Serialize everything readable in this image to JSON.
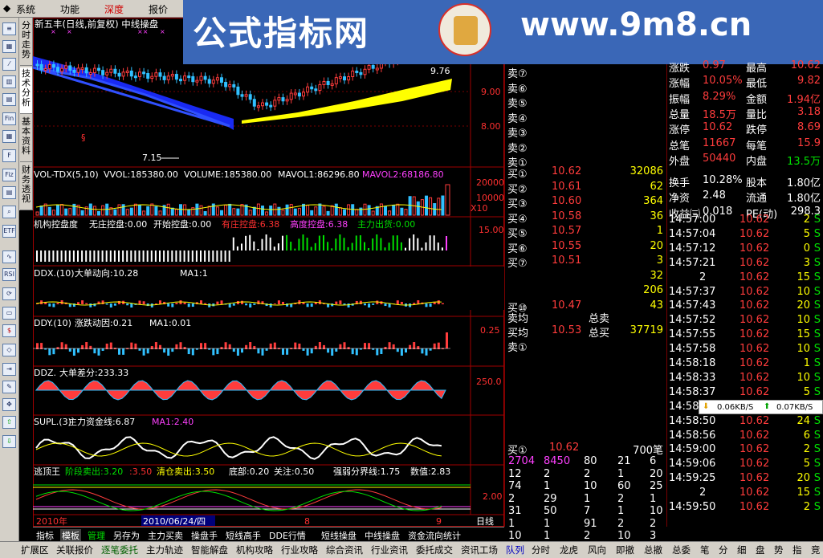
{
  "menu": [
    "系统",
    "功能",
    "深度",
    "报价"
  ],
  "side_tabs": [
    "分时走势",
    "技术分析",
    "基本资料",
    "财务透视"
  ],
  "banner": {
    "left": "公式指标网",
    "right": "www.9m8.cn"
  },
  "chart": {
    "title": "新五丰(日线,前复权) 中线操盘",
    "price_labels": {
      "p976": "9.76",
      "p900": "9.00",
      "p800": "8.00",
      "low": "7.15"
    },
    "vol_header": {
      "a": "VOL-TDX(5,10)",
      "b": "VVOL:185380.00",
      "c": "VOLUME:185380.00",
      "d": "MAVOL1:86296.80",
      "e": "MAVOL2:68186.80"
    },
    "vol_axis": {
      "a": "20000",
      "b": "10000",
      "c": "X10"
    },
    "p3_header": {
      "a": "机构控盘度",
      "b": "无庄控盘:0.00",
      "c": "开始控盘:0.00",
      "d": "有庄控盘:6.38",
      "e": "高度控盘:6.38",
      "f": "主力出货:0.00"
    },
    "p3_axis": "15.00",
    "ddx": {
      "a": "DDX.(10)",
      "b": "大单动向:10.28",
      "c": "MA1:1"
    },
    "ddy": {
      "a": "DDY.(10)",
      "b": "涨跌动因:0.21",
      "c": "MA1:0.01"
    },
    "ddy_axis": "0.25",
    "ddz": {
      "a": "DDZ.",
      "b": "大单差分:233.33"
    },
    "ddz_axis": "250.0",
    "supl": {
      "a": "SUPL.(3)",
      "b": "主力资金线:6.87",
      "c": "MA1:2.40"
    },
    "escape": {
      "a": "逃顶王",
      "b": "阶段卖出:3.20",
      "c": ":3.50",
      "d": "清仓卖出:3.50",
      "e": "底部:0.20",
      "f": "关注:0.50",
      "g": "强弱分界线:1.75",
      "h": "数值:2.83"
    },
    "escape_axis": "2.00",
    "dates": {
      "a": "2010年",
      "b": "2010/06/24/四",
      "c": "8",
      "d": "9",
      "e": "日线"
    }
  },
  "orderbook": {
    "sells": [
      "卖⑦",
      "卖⑥",
      "卖⑤",
      "卖④",
      "卖③",
      "卖②",
      "卖①"
    ],
    "buys": [
      {
        "l": "买①",
        "p": "10.62",
        "v": "32086"
      },
      {
        "l": "买②",
        "p": "10.61",
        "v": "62"
      },
      {
        "l": "买③",
        "p": "10.60",
        "v": "364"
      },
      {
        "l": "买④",
        "p": "10.58",
        "v": "36"
      },
      {
        "l": "买⑤",
        "p": "10.57",
        "v": "1"
      },
      {
        "l": "买⑥",
        "p": "10.55",
        "v": "20"
      },
      {
        "l": "买⑦",
        "p": "10.51",
        "v": "3"
      },
      {
        "l": "",
        "p": "",
        "v": "32"
      },
      {
        "l": "",
        "p": "",
        "v": "206"
      },
      {
        "l": "买⑩",
        "p": "10.47",
        "v": "43"
      }
    ],
    "avg": {
      "sell_avg": "卖均",
      "sell_total": "总卖",
      "buy_avg": "买均",
      "buy_avg_v": "10.53",
      "buy_total": "总买",
      "buy_total_v": "37719",
      "sell1": "卖①"
    },
    "queue": {
      "label": "买①",
      "price": "10.62",
      "count": "700笔"
    },
    "queue_rows": [
      [
        "2704",
        "8450",
        "80",
        "21",
        "6"
      ],
      [
        "12",
        "2",
        "2",
        "1",
        "20"
      ],
      [
        "74",
        "1",
        "10",
        "60",
        "25"
      ],
      [
        "2",
        "29",
        "1",
        "2",
        "1"
      ],
      [
        "31",
        "50",
        "7",
        "1",
        "10"
      ],
      [
        "1",
        "1",
        "91",
        "2",
        "2"
      ],
      [
        "10",
        "1",
        "2",
        "10",
        "3"
      ]
    ]
  },
  "stats": {
    "rows": [
      [
        "涨跌",
        "0.97",
        "最高",
        "10.62"
      ],
      [
        "涨幅",
        "10.05%",
        "最低",
        "9.82"
      ],
      [
        "振幅",
        "8.29%",
        "金额",
        "1.94亿"
      ],
      [
        "总量",
        "18.5万",
        "量比",
        "3.18"
      ],
      [
        "涨停",
        "10.62",
        "跌停",
        "8.69"
      ],
      [
        "总笔",
        "11667",
        "每笔",
        "15.9"
      ],
      [
        "外盘",
        "50440",
        "内盘",
        "13.5万"
      ],
      [
        "换手",
        "10.28%",
        "股本",
        "1.80亿"
      ],
      [
        "净资",
        "2.48",
        "流通",
        "1.80亿"
      ],
      [
        "收益㈢",
        "0.018",
        "PE(动)",
        "298.3"
      ]
    ]
  },
  "ticks": [
    [
      "14:57:00",
      "10.62",
      "2",
      "S"
    ],
    [
      "14:57:04",
      "10.62",
      "5",
      "S"
    ],
    [
      "14:57:12",
      "10.62",
      "0",
      "S"
    ],
    [
      "14:57:21",
      "10.62",
      "3",
      "S"
    ],
    [
      "2",
      "10.62",
      "15",
      "S"
    ],
    [
      "14:57:37",
      "10.62",
      "10",
      "S"
    ],
    [
      "14:57:43",
      "10.62",
      "20",
      "S"
    ],
    [
      "14:57:52",
      "10.62",
      "10",
      "S"
    ],
    [
      "14:57:55",
      "10.62",
      "15",
      "S"
    ],
    [
      "14:57:58",
      "10.62",
      "10",
      "S"
    ],
    [
      "14:58:18",
      "10.62",
      "1",
      "S"
    ],
    [
      "14:58:33",
      "10.62",
      "10",
      "S"
    ],
    [
      "14:58:37",
      "10.62",
      "5",
      "S"
    ],
    [
      "14:58:43",
      "10.62",
      "1",
      "S"
    ],
    [
      "14:58:50",
      "10.62",
      "24",
      "S"
    ],
    [
      "14:58:56",
      "10.62",
      "6",
      "S"
    ],
    [
      "14:59:00",
      "10.62",
      "2",
      "S"
    ],
    [
      "14:59:06",
      "10.62",
      "5",
      "S"
    ],
    [
      "14:59:25",
      "10.62",
      "20",
      "S"
    ],
    [
      "2",
      "10.62",
      "15",
      "S"
    ],
    [
      "14:59:50",
      "10.62",
      "2",
      "S"
    ]
  ],
  "speed": {
    "down": "0.06KB/S",
    "up": "0.07KB/S"
  },
  "tabs1": [
    "指标",
    "模板",
    "管理",
    "另存为",
    "主力买卖",
    "操盘手",
    "短线高手",
    "DDE行情",
    "短线操盘",
    "中线操盘",
    "资金流向统计"
  ],
  "tabs2": [
    "扩展区",
    "关联报价",
    "逐笔委托",
    "主力轨迹",
    "智能解盘",
    "机构攻略",
    "行业攻略",
    "综合资讯",
    "行业资讯",
    "委托成交",
    "资讯工场",
    "队列",
    "分时",
    "龙虎",
    "风向",
    "即撤",
    "总撤",
    "总委",
    "笔",
    "分",
    "细",
    "盘",
    "势",
    "指",
    "竞",
    "筹"
  ]
}
